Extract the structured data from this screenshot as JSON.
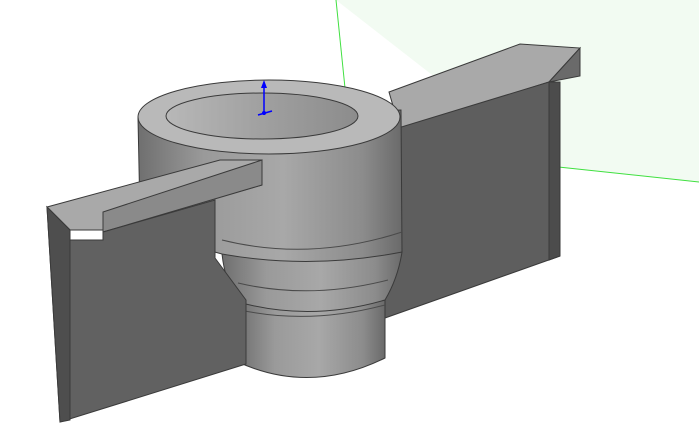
{
  "viewport": {
    "background": "#ffffff",
    "plane_fill": "#eefaee",
    "plane_edge": "#40e040",
    "part_body": "#8a8a8a",
    "part_dark": "#5e5e5e",
    "part_light": "#b4b4b4",
    "triad_color": "#0000ff"
  },
  "part": {
    "icons": [
      "3d-model",
      "reference-plane",
      "origin-triad"
    ]
  }
}
